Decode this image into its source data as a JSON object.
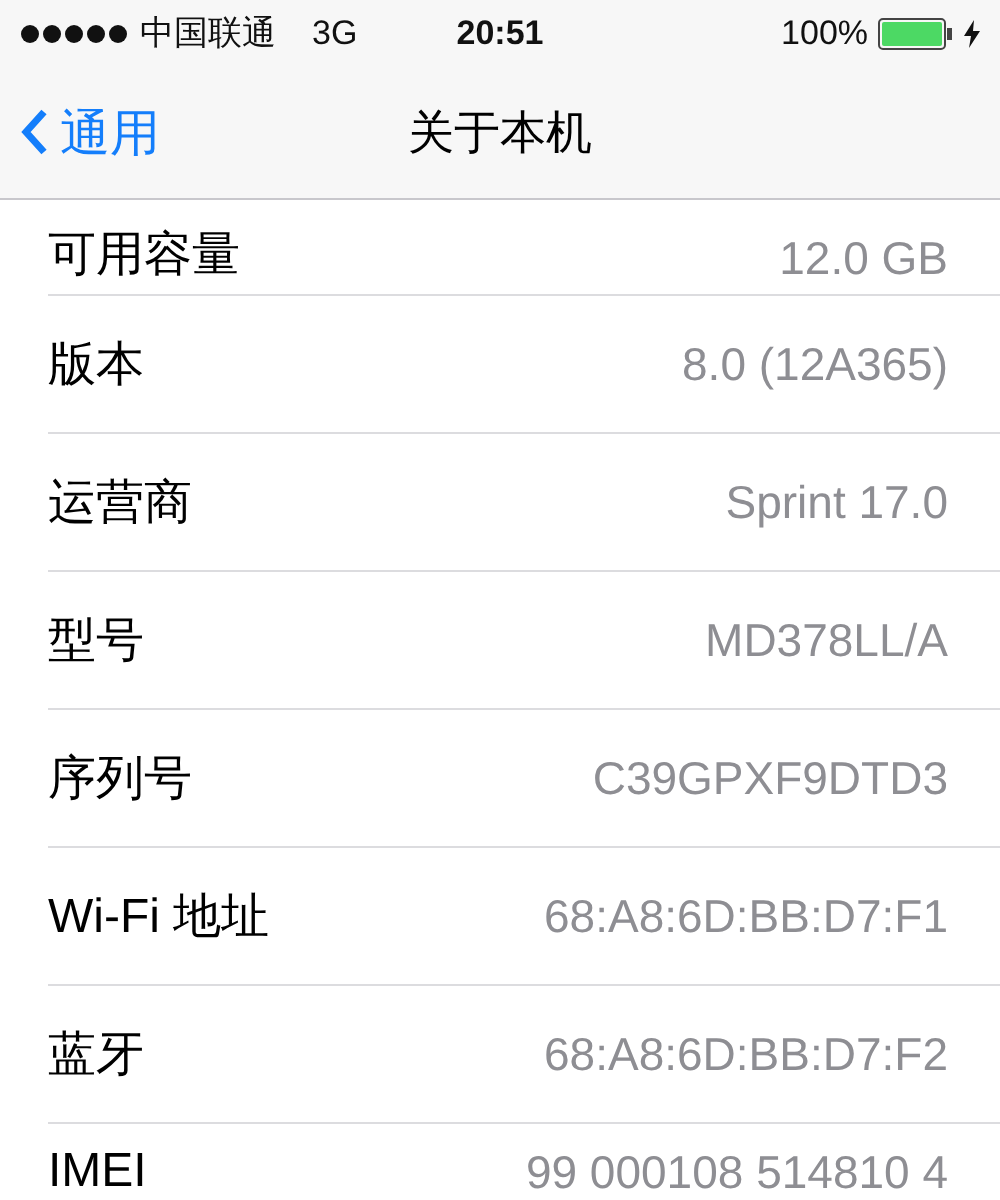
{
  "status_bar": {
    "carrier": "中国联通",
    "network": "3G",
    "time": "20:51",
    "battery": "100%"
  },
  "nav_bar": {
    "back": "通用",
    "title": "关于本机"
  },
  "rows": [
    {
      "label": "可用容量",
      "value": "12.0 GB"
    },
    {
      "label": "版本",
      "value": "8.0 (12A365)"
    },
    {
      "label": "运营商",
      "value": "Sprint 17.0"
    },
    {
      "label": "型号",
      "value": "MD378LL/A"
    },
    {
      "label": "序列号",
      "value": "C39GPXF9DTD3"
    },
    {
      "label": "Wi-Fi 地址",
      "value": "68:A8:6D:BB:D7:F1"
    },
    {
      "label": "蓝牙",
      "value": "68:A8:6D:BB:D7:F2"
    },
    {
      "label": "IMEI",
      "value": "99 000108 514810 4"
    }
  ]
}
